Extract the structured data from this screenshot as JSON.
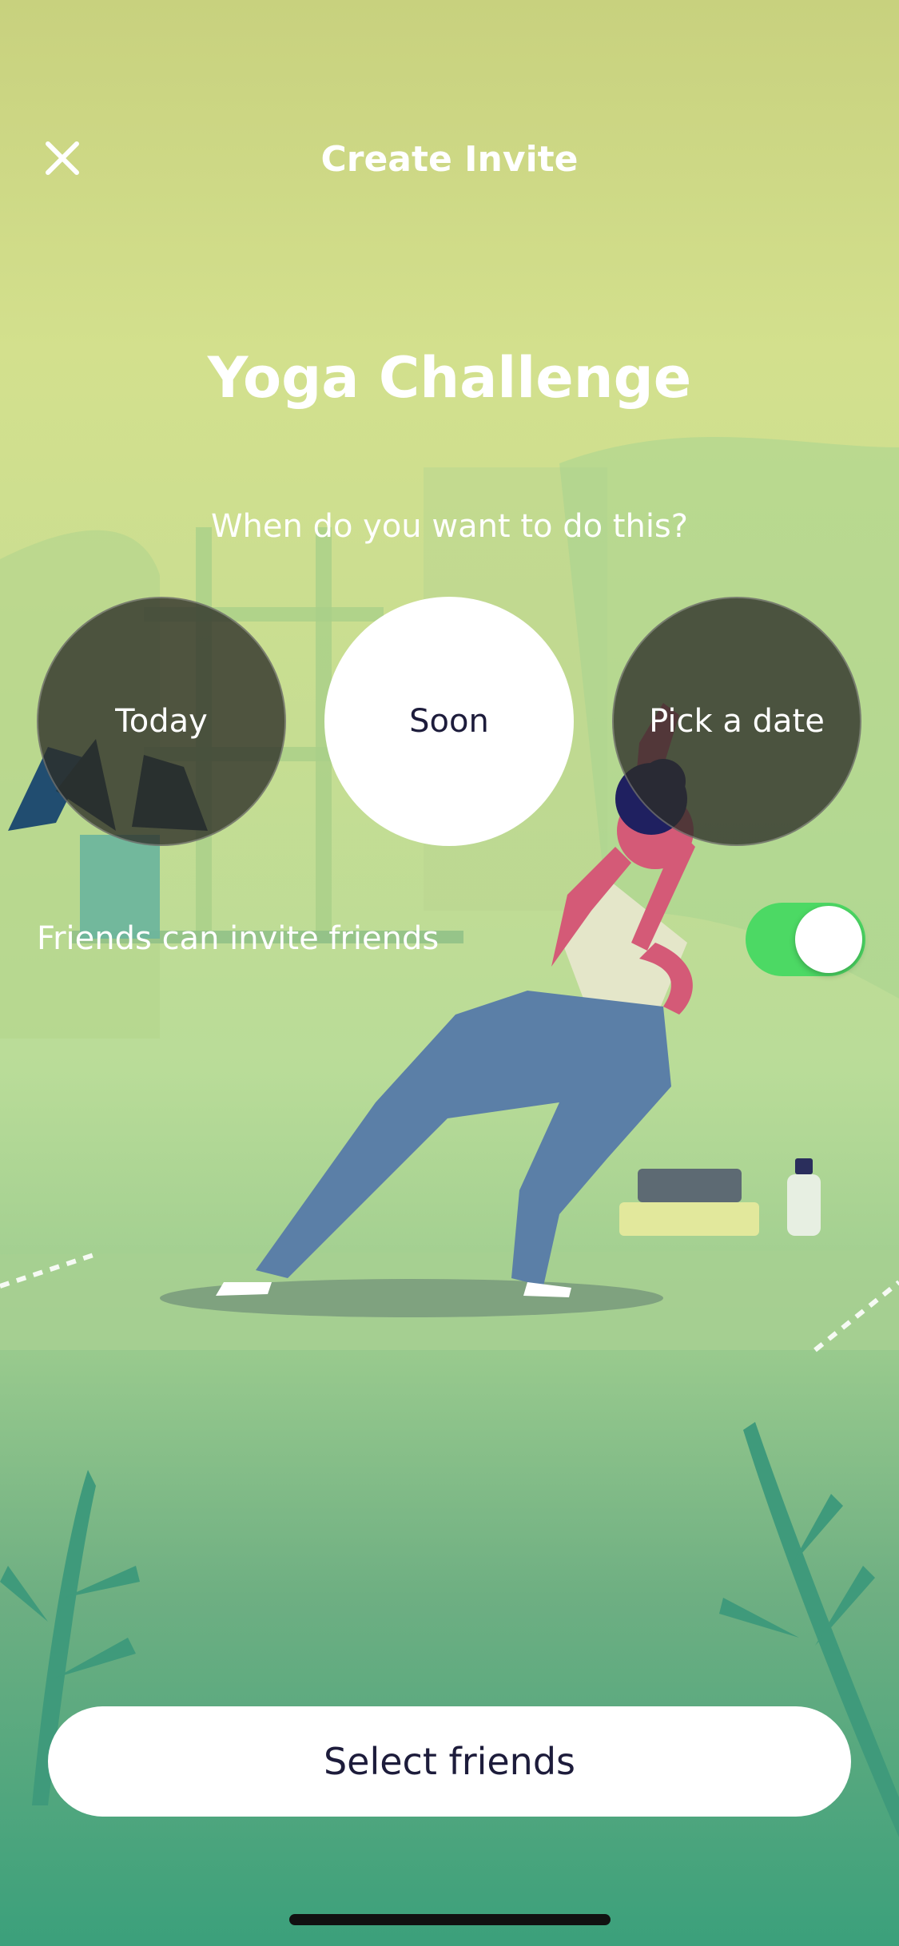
{
  "header": {
    "close_icon": "close-icon",
    "title": "Create Invite"
  },
  "main": {
    "title": "Yoga Challenge",
    "question": "When do you want to do this?",
    "options": [
      {
        "label": "Today",
        "selected": false
      },
      {
        "label": "Soon",
        "selected": true
      },
      {
        "label": "Pick a date",
        "selected": false
      }
    ],
    "toggle": {
      "label": "Friends can invite friends",
      "on": true
    }
  },
  "footer": {
    "cta_label": "Select friends"
  },
  "colors": {
    "toggle_on": "#4cd964",
    "text_dark": "#1d1c3b",
    "background_top": "#c8d17e",
    "background_bottom": "#3ba07b"
  }
}
